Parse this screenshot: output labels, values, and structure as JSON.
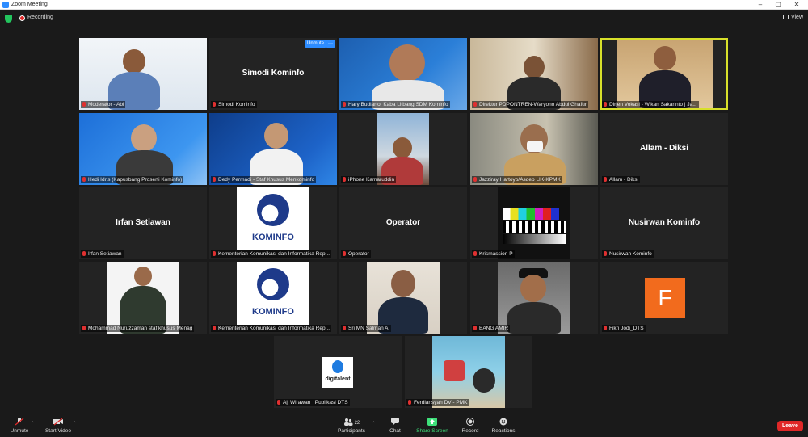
{
  "window": {
    "title": "Zoom Meeting",
    "minimize": "–",
    "maximize": "▢",
    "close": "✕"
  },
  "topbar": {
    "recording_label": "Recording",
    "view_label": "View"
  },
  "tiles": [
    {
      "name": "Moderator - Abi",
      "bigname": ""
    },
    {
      "name": "Simodi Kominfo",
      "bigname": "Simodi Kominfo",
      "unmute": "Unmute",
      "more": "···"
    },
    {
      "name": "Hary Budiarto_Kaba Litbang SDM Kominfo",
      "bigname": ""
    },
    {
      "name": "Direktur PDPONTREN-Waryono Abdul Ghafur",
      "bigname": ""
    },
    {
      "name": "Dirjen Vokasi - Wikan Sakarinto | Ja...",
      "bigname": ""
    },
    {
      "name": "Hedi Idris (Kapusbang Proserti Kominfo)",
      "bigname": ""
    },
    {
      "name": "Dedy Permadi - Staf Khusus Menkominfo",
      "bigname": ""
    },
    {
      "name": "iPhone Kamaruddin",
      "bigname": ""
    },
    {
      "name": "Jazziray Hartoyo/Asdep LIK-KPMK",
      "bigname": ""
    },
    {
      "name": "Allam - Diksi",
      "bigname": "Allam - Diksi"
    },
    {
      "name": "Irfan Setiawan",
      "bigname": "Irfan Setiawan"
    },
    {
      "name": "Kementerian Komunikasi dan Informatika Rep...",
      "bigname": "",
      "logo": "KOMINFO"
    },
    {
      "name": "Operator",
      "bigname": "Operator"
    },
    {
      "name": "Krismassion P",
      "bigname": ""
    },
    {
      "name": "Nusirwan Kominfo",
      "bigname": "Nusirwan Kominfo"
    },
    {
      "name": "Mohammad Nuruzzaman staf khusus Menag",
      "bigname": ""
    },
    {
      "name": "Kementerian Komunikasi dan Informatika Rep...",
      "bigname": "",
      "logo": "KOMINFO"
    },
    {
      "name": "Sri MN Salman A.",
      "bigname": ""
    },
    {
      "name": "BANG AMIR",
      "bigname": ""
    },
    {
      "name": "Fikri Jodi_DTS",
      "bigname": "",
      "initial": "F"
    },
    {
      "name": "Aji Wirawan _Publikasi DTS",
      "bigname": "",
      "logo_text": "digitalent"
    },
    {
      "name": "Ferdiansyah DV - PMK",
      "bigname": ""
    }
  ],
  "bottombar": {
    "unmute": "Unmute",
    "start_video": "Start Video",
    "participants": "Participants",
    "participants_count": "22",
    "chat": "Chat",
    "share_screen": "Share Screen",
    "record": "Record",
    "reactions": "Reactions",
    "leave": "Leave"
  },
  "colors": {
    "accent": "#2d8cff",
    "active_speaker": "#d8e02a",
    "leave": "#e02828",
    "share": "#3ee07a"
  }
}
